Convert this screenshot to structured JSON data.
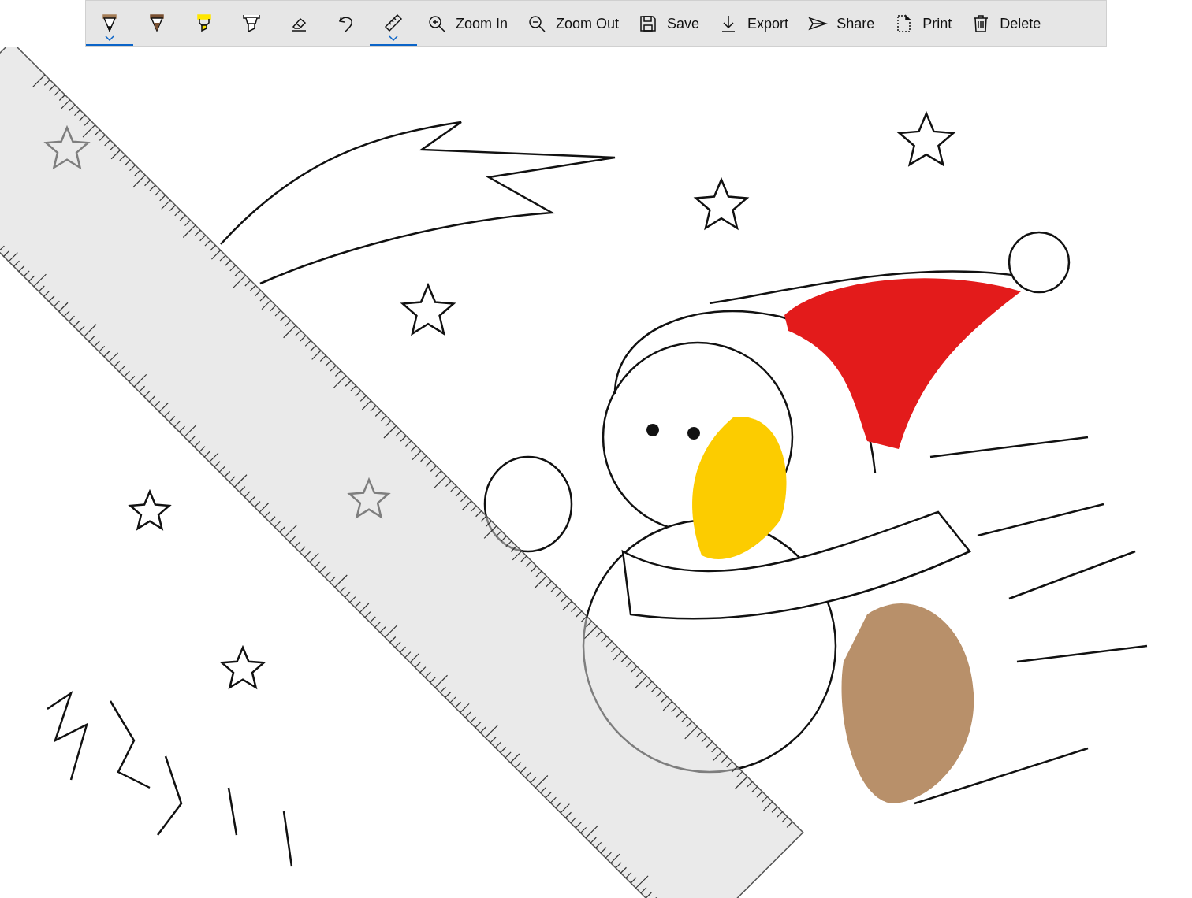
{
  "toolbar": {
    "tools": [
      {
        "kind": "ballpoint",
        "color": "#a57d57",
        "selected": true
      },
      {
        "kind": "pencil",
        "color": "#7b5233",
        "selected": false
      },
      {
        "kind": "highlighter",
        "color": "#ffe600",
        "selected": false
      },
      {
        "kind": "marker",
        "color": "#ffffff",
        "selected": false
      },
      {
        "kind": "eraser",
        "selected": false
      },
      {
        "kind": "undo",
        "selected": false
      },
      {
        "kind": "ruler",
        "selected": true
      }
    ],
    "actions": [
      {
        "kind": "zoom-in",
        "label": "Zoom In"
      },
      {
        "kind": "zoom-out",
        "label": "Zoom Out"
      },
      {
        "kind": "save",
        "label": "Save"
      },
      {
        "kind": "export",
        "label": "Export"
      },
      {
        "kind": "share",
        "label": "Share"
      },
      {
        "kind": "print",
        "label": "Print"
      },
      {
        "kind": "delete",
        "label": "Delete"
      }
    ]
  }
}
